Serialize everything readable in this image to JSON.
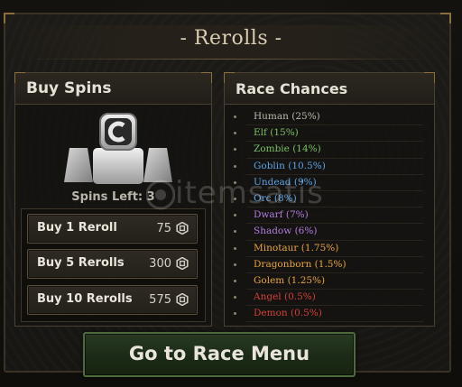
{
  "window": {
    "title": "- Rerolls -"
  },
  "buy_spins": {
    "header": "Buy Spins",
    "icon": "reroll-coin-pedestal-icon",
    "spins_left": "Spins Left: 3",
    "buttons": [
      {
        "label": "Buy 1 Reroll",
        "price": "75",
        "icon": "robux-coin-icon"
      },
      {
        "label": "Buy 5 Rerolls",
        "price": "300",
        "icon": "robux-coin-icon"
      },
      {
        "label": "Buy 10 Rerolls",
        "price": "575",
        "icon": "robux-coin-icon"
      }
    ]
  },
  "race_chances": {
    "header": "Race Chances",
    "items": [
      {
        "text": "Human (25%)",
        "color": "#bdb8ae"
      },
      {
        "text": "Elf (15%)",
        "color": "#7bc063"
      },
      {
        "text": "Zombie (14%)",
        "color": "#7bc063"
      },
      {
        "text": "Goblin (10.5%)",
        "color": "#5aa3e6"
      },
      {
        "text": "Undead (9%)",
        "color": "#5aa3e6"
      },
      {
        "text": "Orc (8%)",
        "color": "#5aa3e6"
      },
      {
        "text": "Dwarf (7%)",
        "color": "#b27de0"
      },
      {
        "text": "Shadow (6%)",
        "color": "#b27de0"
      },
      {
        "text": "Minotaur (1.75%)",
        "color": "#e6a53a"
      },
      {
        "text": "Dragonborn (1.5%)",
        "color": "#e6a53a"
      },
      {
        "text": "Golem (1.25%)",
        "color": "#e6a53a"
      },
      {
        "text": "Angel (0.5%)",
        "color": "#d2403a"
      },
      {
        "text": "Demon (0.5%)",
        "color": "#d2403a"
      }
    ]
  },
  "footer": {
    "go_button": "Go to Race Menu"
  },
  "watermark": {
    "text": "itemsatis"
  },
  "colors": {
    "panel_border": "#4a4132",
    "accent_gold": "#8a6e3e",
    "go_button_border": "#4e6a3c"
  }
}
